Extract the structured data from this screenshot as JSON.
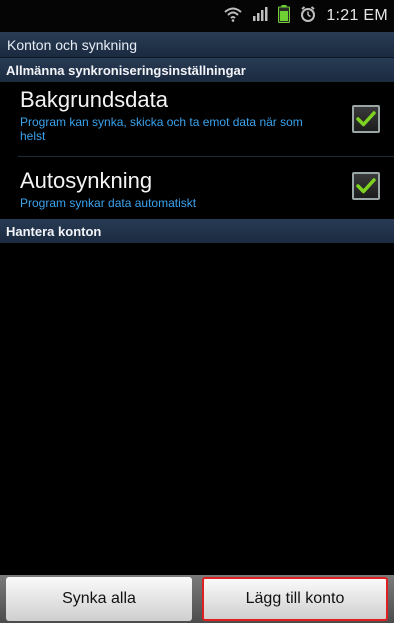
{
  "status_bar": {
    "icons": [
      "wifi-icon",
      "signal-icon",
      "battery-icon",
      "alarm-icon"
    ],
    "time": "1:21 EM"
  },
  "title": "Konton och synkning",
  "general_section": {
    "header": "Allmänna synkroniseringsinställningar",
    "items": [
      {
        "title": "Bakgrundsdata",
        "description": "Program kan synka, skicka och ta emot data när som helst",
        "checked": true
      },
      {
        "title": "Autosynkning",
        "description": "Program synkar data automatiskt",
        "checked": true
      }
    ]
  },
  "accounts_section": {
    "header": "Hantera konton"
  },
  "buttons": {
    "sync_all": "Synka alla",
    "add_account": "Lägg till konto"
  },
  "colors": {
    "accent": "#3aa3ee",
    "check": "#7ed321",
    "highlight": "#e02020"
  }
}
